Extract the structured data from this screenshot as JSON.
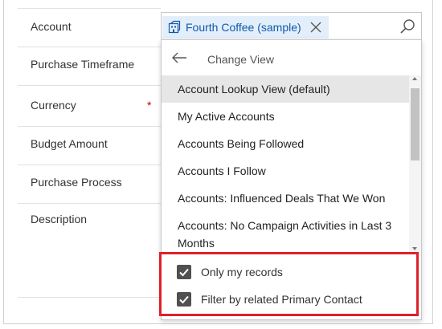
{
  "form": {
    "fields": [
      {
        "label": "Account"
      },
      {
        "label": "Purchase Timeframe"
      },
      {
        "label": "Currency",
        "required_marker": "*"
      },
      {
        "label": "Budget Amount"
      },
      {
        "label": "Purchase Process"
      },
      {
        "label": "Description"
      }
    ]
  },
  "lookup": {
    "selected_value": "Fourth Coffee (sample)",
    "icons": {
      "record": "account-icon",
      "remove": "close-icon",
      "search": "search-icon"
    }
  },
  "flyout": {
    "header": "Change View",
    "back_icon": "arrow-left-icon",
    "views": [
      {
        "label": "Account Lookup View (default)",
        "selected": true
      },
      {
        "label": "My Active Accounts"
      },
      {
        "label": "Accounts Being Followed"
      },
      {
        "label": "Accounts I Follow"
      },
      {
        "label": "Accounts: Influenced Deals That We Won"
      },
      {
        "label": "Accounts: No Campaign Activities in Last 3 Months"
      }
    ],
    "filters": [
      {
        "label": "Only my records",
        "checked": true
      },
      {
        "label": "Filter by related Primary Contact",
        "checked": true
      }
    ]
  },
  "colors": {
    "tag_background": "#e3eefb",
    "tag_text": "#0f5aa8",
    "selected_row": "#e6e6e6",
    "highlight_border": "#e0202a",
    "checkbox": "#505050"
  }
}
